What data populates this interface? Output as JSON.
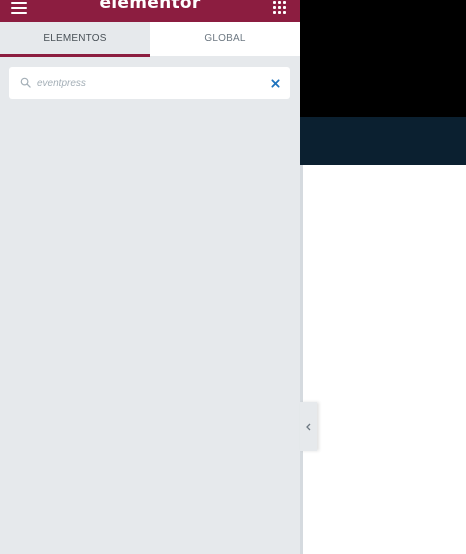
{
  "header": {
    "logo_text": "elementor",
    "menu_icon": "hamburger-menu-icon",
    "apps_icon": "apps-grid-icon",
    "background_color": "#8c1d40"
  },
  "tabs": [
    {
      "label": "ELEMENTOS",
      "active": true
    },
    {
      "label": "GLOBAL",
      "active": false
    }
  ],
  "search": {
    "value": "eventpress",
    "search_icon": "search-icon",
    "clear_icon": "close-icon"
  },
  "preview": {
    "hero_color": "#000000",
    "band_color": "#0b2030"
  },
  "collapse_toggle": {
    "icon": "chevron-left-icon"
  }
}
